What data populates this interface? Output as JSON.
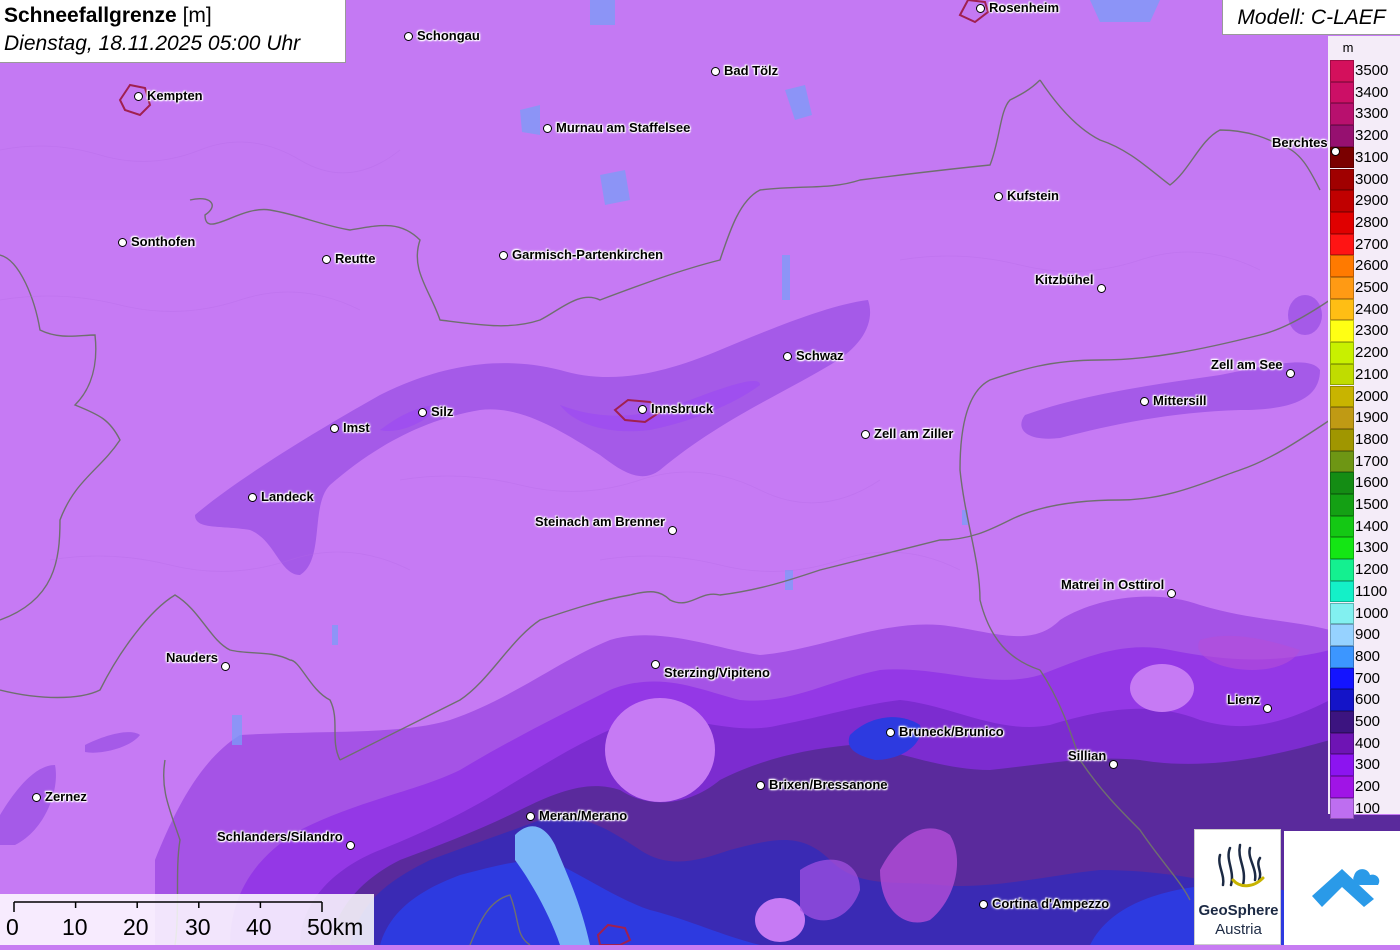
{
  "title": {
    "main": "Schneefallgrenze",
    "unit": "[m]",
    "datetime": "Dienstag, 18.11.2025 05:00 Uhr"
  },
  "model": "Modell: C-LAEF",
  "legend": {
    "unit": "m",
    "entries": [
      {
        "value": "3500",
        "color": "#d4105c"
      },
      {
        "value": "3400",
        "color": "#cc0f66"
      },
      {
        "value": "3300",
        "color": "#b8106e"
      },
      {
        "value": "3200",
        "color": "#961070"
      },
      {
        "value": "3100",
        "color": "#7a0000"
      },
      {
        "value": "3000",
        "color": "#a00000"
      },
      {
        "value": "2900",
        "color": "#c00000"
      },
      {
        "value": "2800",
        "color": "#e00000"
      },
      {
        "value": "2700",
        "color": "#ff1414"
      },
      {
        "value": "2600",
        "color": "#ff7a00"
      },
      {
        "value": "2500",
        "color": "#ff9a14"
      },
      {
        "value": "2400",
        "color": "#ffbe14"
      },
      {
        "value": "2300",
        "color": "#ffff14"
      },
      {
        "value": "2200",
        "color": "#c8f000"
      },
      {
        "value": "2100",
        "color": "#c0dc00"
      },
      {
        "value": "2000",
        "color": "#c8b400"
      },
      {
        "value": "1900",
        "color": "#c09a14"
      },
      {
        "value": "1800",
        "color": "#a09600"
      },
      {
        "value": "1700",
        "color": "#6e9614"
      },
      {
        "value": "1600",
        "color": "#148c14"
      },
      {
        "value": "1500",
        "color": "#14a014"
      },
      {
        "value": "1400",
        "color": "#14c814"
      },
      {
        "value": "1300",
        "color": "#14e614"
      },
      {
        "value": "1200",
        "color": "#14f090"
      },
      {
        "value": "1100",
        "color": "#14f0c8"
      },
      {
        "value": "1000",
        "color": "#82f0f0"
      },
      {
        "value": "900",
        "color": "#96d2ff"
      },
      {
        "value": "800",
        "color": "#3c96ff"
      },
      {
        "value": "700",
        "color": "#1414ff"
      },
      {
        "value": "600",
        "color": "#1414c8"
      },
      {
        "value": "500",
        "color": "#3c1480"
      },
      {
        "value": "400",
        "color": "#6e14b4"
      },
      {
        "value": "300",
        "color": "#8c14f0"
      },
      {
        "value": "200",
        "color": "#a014e6"
      },
      {
        "value": "100",
        "color": "#be6ef0"
      }
    ]
  },
  "cities": [
    {
      "name": "Rosenheim"
    },
    {
      "name": "Schongau"
    },
    {
      "name": "Kempten"
    },
    {
      "name": "Bad Tölz"
    },
    {
      "name": "Murnau am Staffelsee"
    },
    {
      "name": "Berchtes"
    },
    {
      "name": "Kufstein"
    },
    {
      "name": "Sonthofen"
    },
    {
      "name": "Reutte"
    },
    {
      "name": "Garmisch-Partenkirchen"
    },
    {
      "name": "Kitzbühel"
    },
    {
      "name": "Schwaz"
    },
    {
      "name": "Zell am See"
    },
    {
      "name": "Mittersill"
    },
    {
      "name": "Silz"
    },
    {
      "name": "Innsbruck"
    },
    {
      "name": "Imst"
    },
    {
      "name": "Zell am Ziller"
    },
    {
      "name": "Landeck"
    },
    {
      "name": "Steinach am Brenner"
    },
    {
      "name": "Matrei in Osttirol"
    },
    {
      "name": "Nauders"
    },
    {
      "name": "Sterzing/Vipiteno"
    },
    {
      "name": "Lienz"
    },
    {
      "name": "Bruneck/Brunico"
    },
    {
      "name": "Sillian"
    },
    {
      "name": "Zernez"
    },
    {
      "name": "Brixen/Bressanone"
    },
    {
      "name": "Meran/Merano"
    },
    {
      "name": "Schlanders/Silandro"
    },
    {
      "name": "Cortina d'Ampezzo"
    }
  ],
  "scale": {
    "labels": [
      "0",
      "10",
      "20",
      "30",
      "40",
      "50km"
    ]
  },
  "logos": {
    "geosphere_name": "GeoSphere",
    "geosphere_sub": "Austria"
  }
}
